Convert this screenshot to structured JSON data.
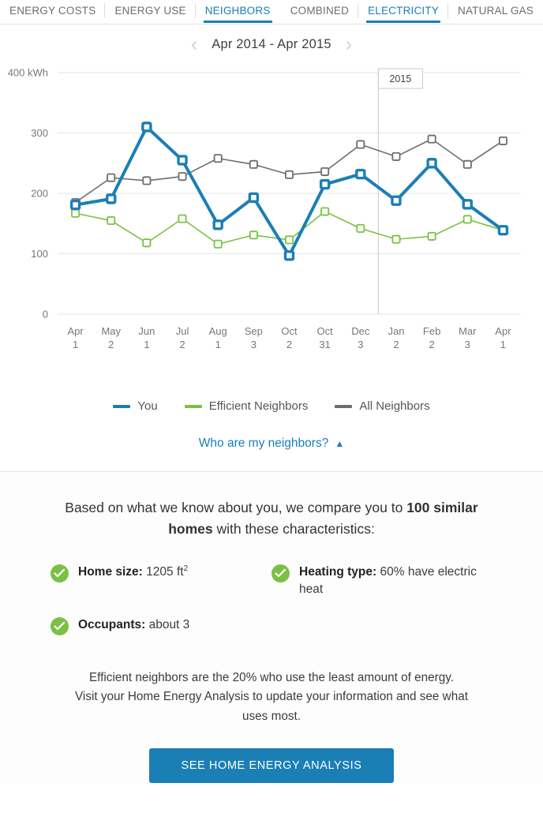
{
  "tabs": {
    "primary": [
      {
        "label": "ENERGY COSTS",
        "active": false
      },
      {
        "label": "ENERGY USE",
        "active": false
      },
      {
        "label": "NEIGHBORS",
        "active": true
      }
    ],
    "secondary": [
      {
        "label": "COMBINED",
        "active": false
      },
      {
        "label": "ELECTRICITY",
        "active": true
      },
      {
        "label": "NATURAL GAS",
        "active": false
      }
    ]
  },
  "date_nav": {
    "prev_icon": "chevron-left-icon",
    "next_icon": "chevron-right-icon",
    "range": "Apr 2014 - Apr 2015"
  },
  "chart_data": {
    "type": "line",
    "title": "",
    "xlabel": "",
    "ylabel": "",
    "y_unit": "kWh",
    "ylim": [
      0,
      400
    ],
    "yticks": [
      0,
      100,
      200,
      300,
      400
    ],
    "ytick_labels": [
      "0",
      "100",
      "200",
      "300",
      "400 kWh"
    ],
    "grid": true,
    "legend_position": "bottom",
    "year_marker": {
      "label": "2015",
      "after_category_index": 8
    },
    "categories": [
      "Apr 1",
      "May 2",
      "Jun 1",
      "Jul 2",
      "Aug 1",
      "Sep 3",
      "Oct 2",
      "Oct 31",
      "Dec 3",
      "Jan 2",
      "Feb 2",
      "Mar 3",
      "Apr 1"
    ],
    "category_months": [
      "Apr",
      "May",
      "Jun",
      "Jul",
      "Aug",
      "Sep",
      "Oct",
      "Oct",
      "Dec",
      "Jan",
      "Feb",
      "Mar",
      "Apr"
    ],
    "category_days": [
      "1",
      "2",
      "1",
      "2",
      "1",
      "3",
      "2",
      "31",
      "3",
      "2",
      "2",
      "3",
      "1"
    ],
    "series": [
      {
        "name": "You",
        "color": "#1a7fb5",
        "values": [
          181,
          191,
          310,
          255,
          148,
          193,
          97,
          215,
          232,
          188,
          250,
          182,
          139
        ]
      },
      {
        "name": "Efficient Neighbors",
        "color": "#7ac143",
        "values": [
          167,
          155,
          118,
          158,
          116,
          131,
          123,
          170,
          142,
          124,
          129,
          157,
          139
        ]
      },
      {
        "name": "All Neighbors",
        "color": "#6d6d6d",
        "values": [
          185,
          226,
          221,
          228,
          258,
          248,
          231,
          236,
          281,
          261,
          290,
          248,
          287
        ]
      }
    ]
  },
  "who_are_neighbors": {
    "label": "Who are my neighbors?",
    "caret": "▲"
  },
  "comparison": {
    "intro_prefix": "Based on what we know about you, we compare you to ",
    "intro_bold_count": "100",
    "intro_bold_tail": "similar homes",
    "intro_suffix": " with these characteristics:",
    "facts": [
      {
        "label": "Home size:",
        "value": "1205 ft",
        "sup": "2"
      },
      {
        "label": "Heating type:",
        "value": "60% have electric heat",
        "sup": ""
      },
      {
        "label": "Occupants:",
        "value": "about 3",
        "sup": ""
      }
    ],
    "note_line1": "Efficient neighbors are the 20% who use the least amount of energy.",
    "note_line2": "Visit your Home Energy Analysis to update your information and see what",
    "note_line3": "uses most.",
    "cta_label": "SEE HOME ENERGY ANALYSIS"
  },
  "colors": {
    "accent": "#1a7fb5",
    "you": "#1a7fb5",
    "efficient": "#7ac143",
    "all": "#6d6d6d"
  }
}
